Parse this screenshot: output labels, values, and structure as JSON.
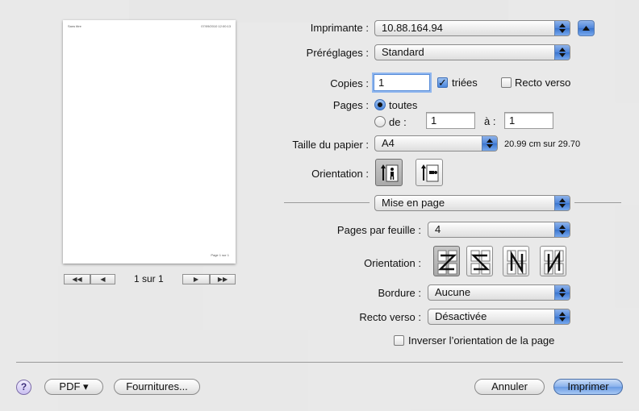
{
  "preview": {
    "page_header_left": "Sans titre",
    "page_header_right": "07/09/2010 12:00:13",
    "page_footer": "Page 1 sur 1",
    "page_counter": "1 sur 1",
    "nav_first": "◀◀",
    "nav_prev": "◀",
    "nav_next": "▶",
    "nav_last": "▶▶"
  },
  "printer": {
    "label": "Imprimante :",
    "value": "10.88.164.94"
  },
  "presets": {
    "label": "Préréglages :",
    "value": "Standard"
  },
  "copies": {
    "label": "Copies :",
    "value": "1",
    "collated_label": "triées",
    "collated": true,
    "duplex_label": "Recto verso",
    "duplex": false
  },
  "pages": {
    "label": "Pages :",
    "all_label": "toutes",
    "range_label": "de :",
    "from": "1",
    "to_label": "à :",
    "to": "1"
  },
  "paper": {
    "label": "Taille du papier :",
    "value": "A4",
    "dimensions": "20.99 cm sur 29.70"
  },
  "orientation": {
    "label": "Orientation :"
  },
  "section": {
    "value": "Mise en page"
  },
  "layout": {
    "pages_per_sheet_label": "Pages par feuille :",
    "pages_per_sheet": "4",
    "direction_label": "Orientation :",
    "border_label": "Bordure :",
    "border": "Aucune",
    "two_sided_label": "Recto verso :",
    "two_sided": "Désactivée",
    "reverse_label": "Inverser l’orientation de la page",
    "reverse": false
  },
  "footer": {
    "help": "?",
    "pdf": "PDF ▾",
    "supplies": "Fournitures...",
    "cancel": "Annuler",
    "print": "Imprimer"
  },
  "colors": {
    "accent": "#4e86db",
    "default_button": "#88b1ec"
  }
}
